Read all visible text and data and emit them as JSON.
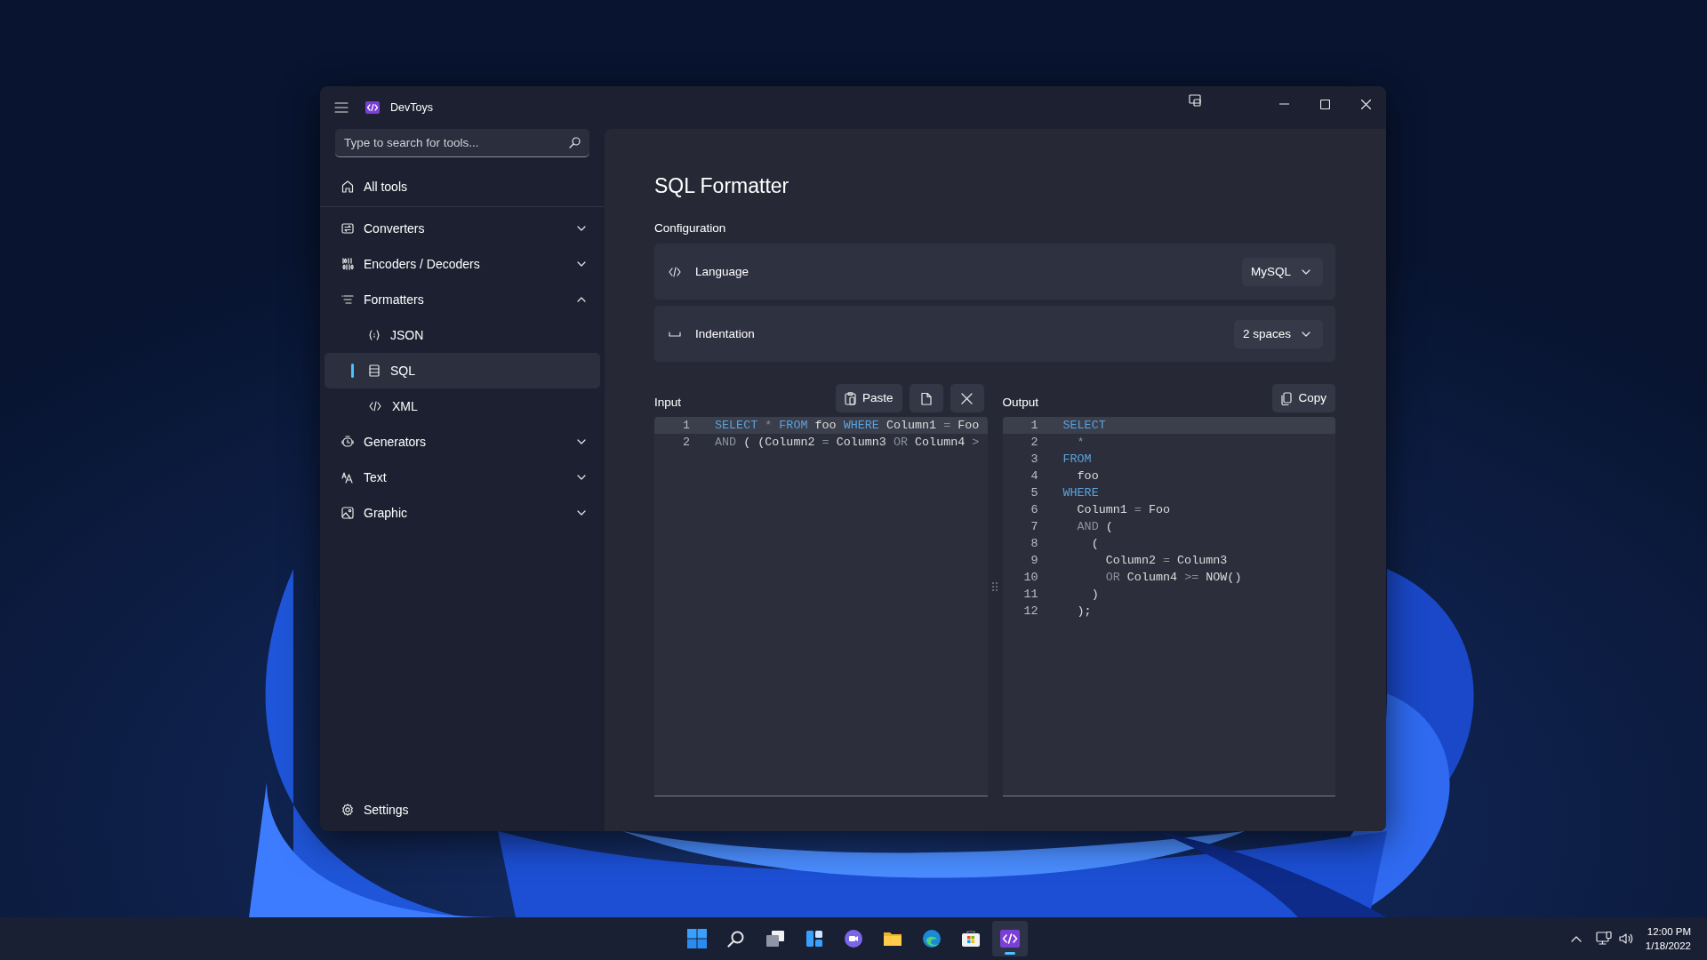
{
  "window": {
    "title": "DevToys"
  },
  "sidebar": {
    "search": {
      "placeholder": "Type to search for tools..."
    },
    "home": {
      "label": "All tools",
      "selected": false
    },
    "groups": [
      {
        "kind": "converters",
        "label": "Converters",
        "expanded": false,
        "selected": false
      },
      {
        "kind": "encoders",
        "label": "Encoders / Decoders",
        "expanded": false,
        "selected": false
      },
      {
        "kind": "formatters",
        "label": "Formatters",
        "expanded": true,
        "selected": false,
        "children": [
          {
            "kind": "json",
            "label": "JSON",
            "selected": false
          },
          {
            "kind": "sql",
            "label": "SQL",
            "selected": true
          },
          {
            "kind": "xml",
            "label": "XML",
            "selected": false
          }
        ]
      },
      {
        "kind": "generators",
        "label": "Generators",
        "expanded": false,
        "selected": false
      },
      {
        "kind": "text",
        "label": "Text",
        "expanded": false,
        "selected": false
      },
      {
        "kind": "graphic",
        "label": "Graphic",
        "expanded": false,
        "selected": false
      }
    ],
    "settings": {
      "label": "Settings",
      "selected": false
    }
  },
  "page": {
    "title": "SQL Formatter",
    "section": "Configuration",
    "settings": [
      {
        "kind": "language",
        "label": "Language",
        "value": "MySQL"
      },
      {
        "kind": "indentation",
        "label": "Indentation",
        "value": "2 spaces"
      }
    ],
    "editors": [
      {
        "label": "Input",
        "buttons": [
          {
            "kind": "paste",
            "label": "Paste"
          },
          {
            "kind": "file"
          },
          {
            "kind": "clear"
          }
        ],
        "lines": [
          {
            "number": "1",
            "current": true,
            "tokens": [
              {
                "text": "SELECT",
                "kind": "keyword"
              },
              {
                "text": " * ",
                "kind": "operator"
              },
              {
                "text": "FROM",
                "kind": "keyword"
              },
              {
                "text": " foo ",
                "kind": "plain"
              },
              {
                "text": "WHERE",
                "kind": "keyword"
              },
              {
                "text": " Column1 ",
                "kind": "plain"
              },
              {
                "text": "=",
                "kind": "operator"
              },
              {
                "text": " Foo",
                "kind": "plain"
              }
            ]
          },
          {
            "number": "2",
            "current": false,
            "tokens": [
              {
                "text": "AND",
                "kind": "operator"
              },
              {
                "text": " ( (Column2 ",
                "kind": "plain"
              },
              {
                "text": "=",
                "kind": "operator"
              },
              {
                "text": " Column3 ",
                "kind": "plain"
              },
              {
                "text": "OR",
                "kind": "operator"
              },
              {
                "text": " Column4 ",
                "kind": "plain"
              },
              {
                "text": ">",
                "kind": "operator"
              }
            ]
          }
        ]
      },
      {
        "label": "Output",
        "buttons": [
          {
            "kind": "copy",
            "label": "Copy"
          }
        ],
        "lines": [
          {
            "number": "1",
            "current": true,
            "tokens": [
              {
                "text": "SELECT",
                "kind": "keyword"
              }
            ]
          },
          {
            "number": "2",
            "current": false,
            "tokens": [
              {
                "text": "  *",
                "kind": "operator"
              }
            ]
          },
          {
            "number": "3",
            "current": false,
            "tokens": [
              {
                "text": "FROM",
                "kind": "keyword"
              }
            ]
          },
          {
            "number": "4",
            "current": false,
            "tokens": [
              {
                "text": "  foo",
                "kind": "plain"
              }
            ]
          },
          {
            "number": "5",
            "current": false,
            "tokens": [
              {
                "text": "WHERE",
                "kind": "keyword"
              }
            ]
          },
          {
            "number": "6",
            "current": false,
            "tokens": [
              {
                "text": "  Column1 ",
                "kind": "plain"
              },
              {
                "text": "=",
                "kind": "operator"
              },
              {
                "text": " Foo",
                "kind": "plain"
              }
            ]
          },
          {
            "number": "7",
            "current": false,
            "tokens": [
              {
                "text": "  AND",
                "kind": "operator"
              },
              {
                "text": " (",
                "kind": "plain"
              }
            ]
          },
          {
            "number": "8",
            "current": false,
            "tokens": [
              {
                "text": "    (",
                "kind": "plain"
              }
            ]
          },
          {
            "number": "9",
            "current": false,
            "tokens": [
              {
                "text": "      Column2 ",
                "kind": "plain"
              },
              {
                "text": "=",
                "kind": "operator"
              },
              {
                "text": " Column3",
                "kind": "plain"
              }
            ]
          },
          {
            "number": "10",
            "current": false,
            "tokens": [
              {
                "text": "      OR",
                "kind": "operator"
              },
              {
                "text": " Column4 ",
                "kind": "plain"
              },
              {
                "text": ">=",
                "kind": "operator"
              },
              {
                "text": " NOW()",
                "kind": "plain"
              }
            ]
          },
          {
            "number": "11",
            "current": false,
            "tokens": [
              {
                "text": "    )",
                "kind": "plain"
              }
            ]
          },
          {
            "number": "12",
            "current": false,
            "tokens": [
              {
                "text": "  );",
                "kind": "plain"
              }
            ]
          }
        ]
      }
    ]
  },
  "taskbar": {
    "apps": [
      {
        "kind": "start",
        "selected": false
      },
      {
        "kind": "search",
        "selected": false
      },
      {
        "kind": "taskview",
        "selected": false
      },
      {
        "kind": "widgets",
        "selected": false
      },
      {
        "kind": "chat",
        "selected": false
      },
      {
        "kind": "explorer",
        "selected": false
      },
      {
        "kind": "browser",
        "selected": false
      },
      {
        "kind": "store",
        "selected": false
      },
      {
        "kind": "devtoys",
        "selected": true
      }
    ],
    "clock": {
      "time": "12:00 PM",
      "date": "1/18/2022"
    }
  }
}
